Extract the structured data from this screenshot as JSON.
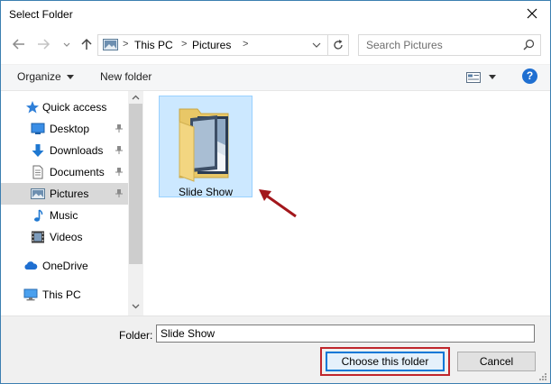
{
  "window": {
    "title": "Select Folder"
  },
  "nav": {
    "address": {
      "segments": [
        "This PC",
        "Pictures"
      ]
    },
    "search": {
      "placeholder": "Search Pictures"
    }
  },
  "toolbar": {
    "organize_label": "Organize",
    "new_folder_label": "New folder",
    "help_label": "?"
  },
  "navpane": {
    "items": [
      {
        "label": "Quick access",
        "icon": "star-icon"
      },
      {
        "label": "Desktop",
        "icon": "desktop-icon",
        "pinned": true
      },
      {
        "label": "Downloads",
        "icon": "download-arrow-icon",
        "pinned": true
      },
      {
        "label": "Documents",
        "icon": "document-icon",
        "pinned": true
      },
      {
        "label": "Pictures",
        "icon": "pictures-icon",
        "pinned": true,
        "selected": true
      },
      {
        "label": "Music",
        "icon": "music-note-icon"
      },
      {
        "label": "Videos",
        "icon": "film-icon"
      },
      {
        "label": "OneDrive",
        "icon": "cloud-icon"
      },
      {
        "label": "This PC",
        "icon": "computer-icon"
      }
    ]
  },
  "content": {
    "items": [
      {
        "label": "Slide Show",
        "type": "folder",
        "selected": true
      }
    ]
  },
  "footer": {
    "folder_label": "Folder:",
    "folder_value": "Slide Show",
    "choose_label": "Choose this folder",
    "cancel_label": "Cancel"
  },
  "colors": {
    "accent": "#0078d7",
    "highlight": "#c0262c",
    "selection": "#cce8ff"
  }
}
